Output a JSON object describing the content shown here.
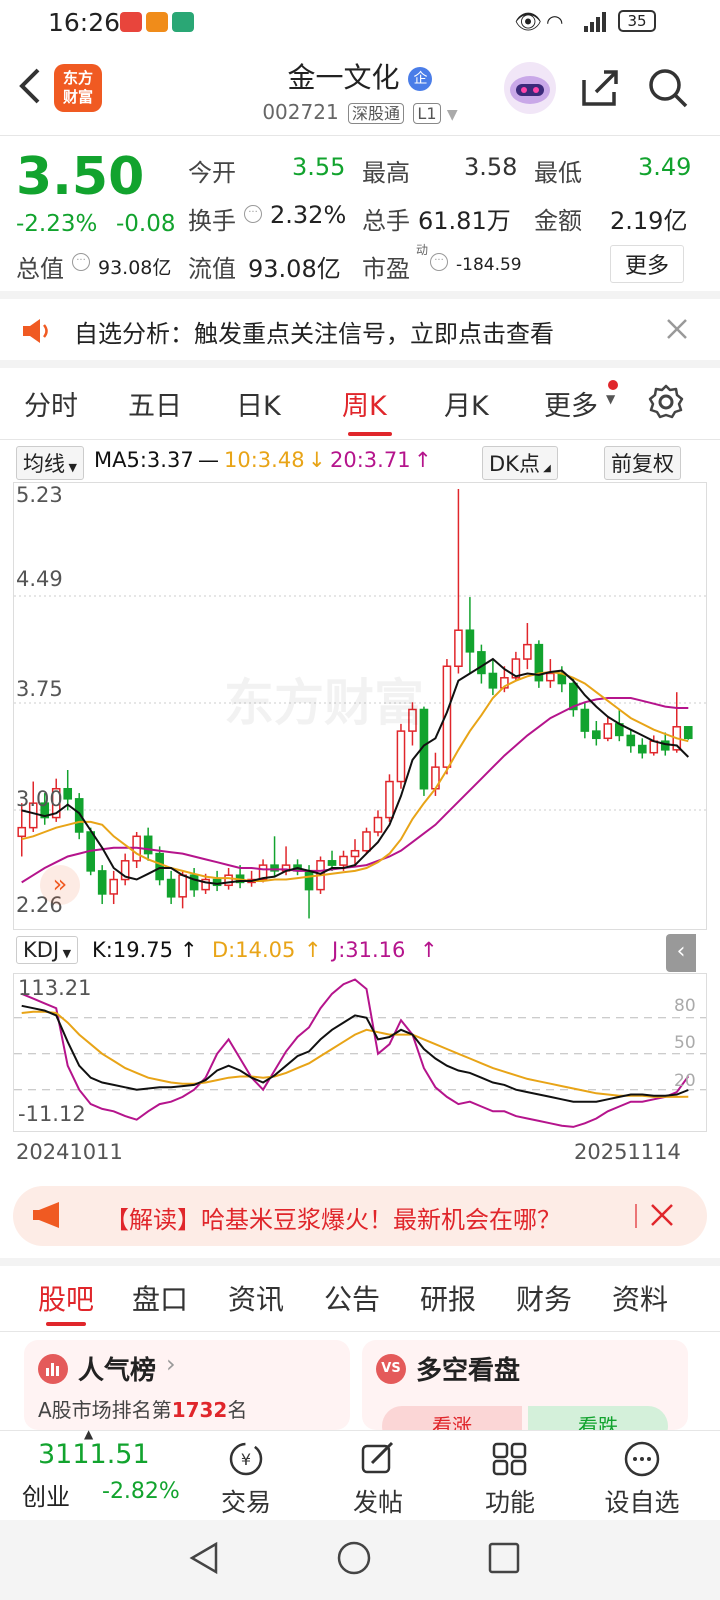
{
  "status": {
    "time": "16:26",
    "battery": "35"
  },
  "nav": {
    "logo_line1": "东方",
    "logo_line2": "财富",
    "title": "金一文化",
    "title_badge": "企",
    "code": "002721",
    "exchange_tag": "深股通",
    "level_tag": "L1"
  },
  "quote": {
    "price": "3.50",
    "change_pct": "-2.23%",
    "change": "-0.08",
    "open_label": "今开",
    "open": "3.55",
    "high_label": "最高",
    "high": "3.58",
    "low_label": "最低",
    "low": "3.49",
    "turnover_label": "换手",
    "turnover": "2.32%",
    "volume_label": "总手",
    "volume": "61.81万",
    "amount_label": "金额",
    "amount": "2.19亿",
    "mktcap_label": "总值",
    "mktcap": "93.08亿",
    "float_label": "流值",
    "float_cap": "93.08亿",
    "pe_label": "市盈",
    "pe_sup": "动",
    "pe": "-184.59",
    "more_label": "更多"
  },
  "banner": {
    "text": "自选分析：触发重点关注信号，立即点击查看"
  },
  "tabs": [
    "分时",
    "五日",
    "日K",
    "周K",
    "月K",
    "更多"
  ],
  "chart_ctl": {
    "ma_select": "均线",
    "ma5": "MA5:3.37",
    "ma10": "10:3.48",
    "ma20": "20:3.71",
    "dk": "DK点",
    "adjust": "前复权"
  },
  "chart_data": {
    "type": "candlestick",
    "y_labels": [
      "5.23",
      "4.49",
      "3.75",
      "3.00",
      "2.26"
    ],
    "ylim": [
      2.26,
      5.23
    ],
    "candles": [
      [
        2.82,
        2.88,
        2.68,
        3.05
      ],
      [
        2.88,
        3.05,
        2.85,
        3.2
      ],
      [
        3.05,
        2.95,
        2.9,
        3.12
      ],
      [
        2.95,
        3.15,
        2.92,
        3.22
      ],
      [
        3.15,
        3.08,
        3.0,
        3.28
      ],
      [
        3.08,
        2.85,
        2.8,
        3.12
      ],
      [
        2.85,
        2.58,
        2.55,
        2.88
      ],
      [
        2.58,
        2.42,
        2.35,
        2.62
      ],
      [
        2.42,
        2.52,
        2.35,
        2.58
      ],
      [
        2.52,
        2.65,
        2.48,
        2.7
      ],
      [
        2.65,
        2.82,
        2.6,
        2.85
      ],
      [
        2.82,
        2.7,
        2.65,
        2.88
      ],
      [
        2.7,
        2.52,
        2.48,
        2.75
      ],
      [
        2.52,
        2.4,
        2.35,
        2.58
      ],
      [
        2.4,
        2.55,
        2.32,
        2.58
      ],
      [
        2.55,
        2.45,
        2.4,
        2.6
      ],
      [
        2.45,
        2.52,
        2.42,
        2.56
      ],
      [
        2.52,
        2.48,
        2.44,
        2.58
      ],
      [
        2.48,
        2.55,
        2.45,
        2.6
      ],
      [
        2.55,
        2.5,
        2.46,
        2.62
      ],
      [
        2.5,
        2.52,
        2.47,
        2.58
      ],
      [
        2.52,
        2.62,
        2.5,
        2.66
      ],
      [
        2.62,
        2.58,
        2.54,
        2.82
      ],
      [
        2.58,
        2.62,
        2.55,
        2.75
      ],
      [
        2.62,
        2.58,
        2.55,
        2.66
      ],
      [
        2.58,
        2.45,
        2.25,
        2.62
      ],
      [
        2.45,
        2.65,
        2.42,
        2.68
      ],
      [
        2.65,
        2.62,
        2.58,
        2.72
      ],
      [
        2.62,
        2.68,
        2.58,
        2.72
      ],
      [
        2.68,
        2.72,
        2.62,
        2.8
      ],
      [
        2.72,
        2.85,
        2.7,
        2.88
      ],
      [
        2.85,
        2.95,
        2.82,
        3.0
      ],
      [
        2.95,
        3.2,
        2.92,
        3.25
      ],
      [
        3.2,
        3.55,
        3.15,
        3.6
      ],
      [
        3.55,
        3.7,
        3.45,
        3.75
      ],
      [
        3.7,
        3.15,
        3.1,
        3.72
      ],
      [
        3.15,
        3.3,
        3.1,
        3.4
      ],
      [
        3.3,
        4.0,
        3.25,
        4.05
      ],
      [
        4.0,
        4.25,
        3.95,
        5.23
      ],
      [
        4.25,
        4.1,
        3.95,
        4.48
      ],
      [
        4.1,
        3.95,
        3.88,
        4.15
      ],
      [
        3.95,
        3.85,
        3.8,
        4.05
      ],
      [
        3.85,
        3.92,
        3.82,
        4.0
      ],
      [
        3.92,
        4.05,
        3.9,
        4.1
      ],
      [
        4.05,
        4.15,
        3.98,
        4.3
      ],
      [
        4.15,
        3.9,
        3.85,
        4.18
      ],
      [
        3.9,
        3.95,
        3.85,
        4.05
      ],
      [
        3.95,
        3.88,
        3.82,
        4.0
      ],
      [
        3.88,
        3.7,
        3.65,
        3.92
      ],
      [
        3.7,
        3.55,
        3.5,
        3.75
      ],
      [
        3.55,
        3.5,
        3.45,
        3.62
      ],
      [
        3.5,
        3.6,
        3.48,
        3.65
      ],
      [
        3.6,
        3.52,
        3.48,
        3.7
      ],
      [
        3.52,
        3.45,
        3.4,
        3.56
      ],
      [
        3.45,
        3.4,
        3.36,
        3.5
      ],
      [
        3.4,
        3.48,
        3.38,
        3.52
      ],
      [
        3.48,
        3.42,
        3.38,
        3.54
      ],
      [
        3.42,
        3.58,
        3.4,
        3.82
      ],
      [
        3.58,
        3.5,
        3.49,
        3.58
      ]
    ],
    "ma5": [
      3.0,
      2.98,
      2.96,
      2.98,
      3.04,
      2.98,
      2.86,
      2.74,
      2.6,
      2.54,
      2.52,
      2.56,
      2.6,
      2.6,
      2.55,
      2.52,
      2.5,
      2.49,
      2.5,
      2.51,
      2.51,
      2.53,
      2.54,
      2.58,
      2.6,
      2.58,
      2.56,
      2.6,
      2.6,
      2.62,
      2.7,
      2.78,
      2.9,
      3.1,
      3.35,
      3.45,
      3.5,
      3.68,
      3.9,
      3.95,
      4.0,
      4.05,
      3.98,
      3.93,
      3.95,
      3.94,
      3.96,
      3.97,
      3.9,
      3.8,
      3.72,
      3.65,
      3.6,
      3.56,
      3.52,
      3.48,
      3.46,
      3.45,
      3.37
    ],
    "ma10": [
      2.8,
      2.82,
      2.85,
      2.88,
      2.9,
      2.92,
      2.92,
      2.9,
      2.82,
      2.76,
      2.7,
      2.66,
      2.63,
      2.6,
      2.58,
      2.56,
      2.54,
      2.53,
      2.53,
      2.52,
      2.51,
      2.51,
      2.52,
      2.52,
      2.53,
      2.54,
      2.55,
      2.56,
      2.57,
      2.58,
      2.6,
      2.64,
      2.7,
      2.8,
      2.94,
      3.05,
      3.15,
      3.28,
      3.42,
      3.55,
      3.66,
      3.78,
      3.86,
      3.9,
      3.93,
      3.95,
      3.96,
      3.95,
      3.92,
      3.88,
      3.82,
      3.76,
      3.7,
      3.64,
      3.6,
      3.56,
      3.53,
      3.5,
      3.48
    ],
    "ma20": [
      2.5,
      2.55,
      2.6,
      2.64,
      2.68,
      2.7,
      2.72,
      2.73,
      2.74,
      2.74,
      2.74,
      2.73,
      2.72,
      2.71,
      2.7,
      2.68,
      2.66,
      2.64,
      2.62,
      2.6,
      2.6,
      2.59,
      2.59,
      2.59,
      2.58,
      2.58,
      2.58,
      2.59,
      2.6,
      2.61,
      2.62,
      2.65,
      2.68,
      2.72,
      2.78,
      2.84,
      2.9,
      2.98,
      3.06,
      3.14,
      3.22,
      3.3,
      3.38,
      3.45,
      3.52,
      3.58,
      3.64,
      3.68,
      3.72,
      3.75,
      3.77,
      3.78,
      3.78,
      3.78,
      3.76,
      3.74,
      3.72,
      3.71,
      3.71
    ],
    "kdj": {
      "y_labels": [
        "113.21",
        "-11.12"
      ],
      "ref_labels": [
        "80",
        "50",
        "20"
      ],
      "ylim": [
        -11.12,
        113.21
      ],
      "K": [
        90,
        88,
        86,
        82,
        60,
        40,
        30,
        26,
        24,
        22,
        20,
        21,
        22,
        22,
        23,
        24,
        28,
        36,
        40,
        36,
        30,
        26,
        32,
        40,
        48,
        52,
        62,
        70,
        76,
        82,
        80,
        62,
        64,
        70,
        66,
        54,
        46,
        40,
        36,
        34,
        30,
        26,
        24,
        20,
        18,
        16,
        14,
        12,
        10,
        10,
        10,
        12,
        14,
        16,
        16,
        15,
        15,
        16,
        19.75
      ],
      "D": [
        84,
        85,
        85,
        84,
        76,
        66,
        58,
        50,
        44,
        38,
        34,
        30,
        28,
        26,
        25,
        25,
        26,
        28,
        30,
        31,
        31,
        30,
        31,
        34,
        38,
        42,
        48,
        54,
        60,
        66,
        70,
        68,
        66,
        66,
        66,
        62,
        58,
        54,
        50,
        46,
        42,
        38,
        35,
        32,
        29,
        27,
        25,
        23,
        21,
        19,
        17,
        16,
        15,
        15,
        15,
        14,
        14,
        14,
        14.05
      ],
      "J": [
        100,
        96,
        92,
        88,
        40,
        20,
        8,
        4,
        2,
        -2,
        -5,
        2,
        8,
        10,
        14,
        20,
        30,
        50,
        62,
        46,
        30,
        20,
        36,
        52,
        64,
        72,
        88,
        100,
        108,
        112,
        104,
        50,
        58,
        78,
        66,
        38,
        22,
        14,
        8,
        10,
        6,
        2,
        2,
        -2,
        -4,
        -6,
        -8,
        -10,
        -11,
        -8,
        -4,
        2,
        6,
        10,
        10,
        12,
        14,
        18,
        31.16
      ]
    },
    "start_date": "20241011",
    "end_date": "20251114"
  },
  "kdj_ctl": {
    "select": "KDJ",
    "k": "K:19.75",
    "d": "D:14.05",
    "j": "J:31.16"
  },
  "promo": {
    "text": "【解读】哈基米豆浆爆火！最新机会在哪？"
  },
  "feature_tabs": [
    "股吧",
    "盘口",
    "资讯",
    "公告",
    "研报",
    "财务",
    "资料"
  ],
  "cards": {
    "popularity_title": "人气榜",
    "popularity_rank_prefix": "A股市场排名第",
    "popularity_rank": "1732",
    "popularity_rank_suffix": "名",
    "vs_title": "多空看盘",
    "vs_up": "看涨",
    "vs_down": "看跌"
  },
  "bottom": {
    "index_value": "3111.51",
    "index_name": "创业",
    "index_change": "-2.82%",
    "trade": "交易",
    "post": "发帖",
    "func": "功能",
    "watch": "设自选"
  },
  "colors": {
    "up": "#e0262b",
    "down": "#12a32e",
    "ma5": "#111111",
    "ma10": "#e8a417",
    "ma20": "#b5148c"
  }
}
